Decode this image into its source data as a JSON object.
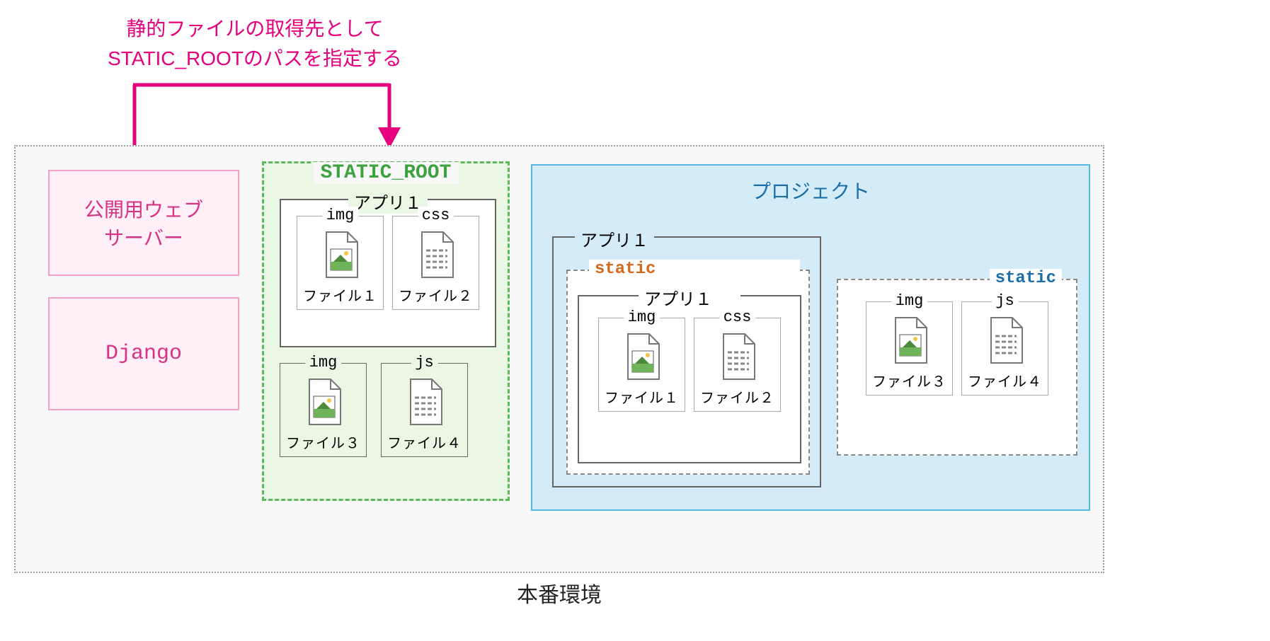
{
  "annotation": {
    "line1": "静的ファイルの取得先として",
    "line2": "STATIC_ROOTのパスを指定する"
  },
  "env_label": "本番環境",
  "servers": {
    "web": "公開用ウェブ\nサーバー",
    "django": "Django"
  },
  "static_root": {
    "label": "STATIC_ROOT",
    "app_label": "アプリ１",
    "files": {
      "img_top": {
        "dir": "img",
        "name": "ファイル１",
        "kind": "image"
      },
      "css_top": {
        "dir": "css",
        "name": "ファイル２",
        "kind": "text"
      },
      "img_bot": {
        "dir": "img",
        "name": "ファイル３",
        "kind": "image"
      },
      "js_bot": {
        "dir": "js",
        "name": "ファイル４",
        "kind": "text"
      }
    }
  },
  "project": {
    "label": "プロジェクト",
    "app1": {
      "label": "アプリ１",
      "static_label": "static",
      "inner_label": "アプリ１",
      "files": {
        "img": {
          "dir": "img",
          "name": "ファイル１",
          "kind": "image"
        },
        "css": {
          "dir": "css",
          "name": "ファイル２",
          "kind": "text"
        }
      }
    },
    "static2": {
      "label": "static",
      "files": {
        "img": {
          "dir": "img",
          "name": "ファイル３",
          "kind": "image"
        },
        "js": {
          "dir": "js",
          "name": "ファイル４",
          "kind": "text"
        }
      }
    }
  }
}
